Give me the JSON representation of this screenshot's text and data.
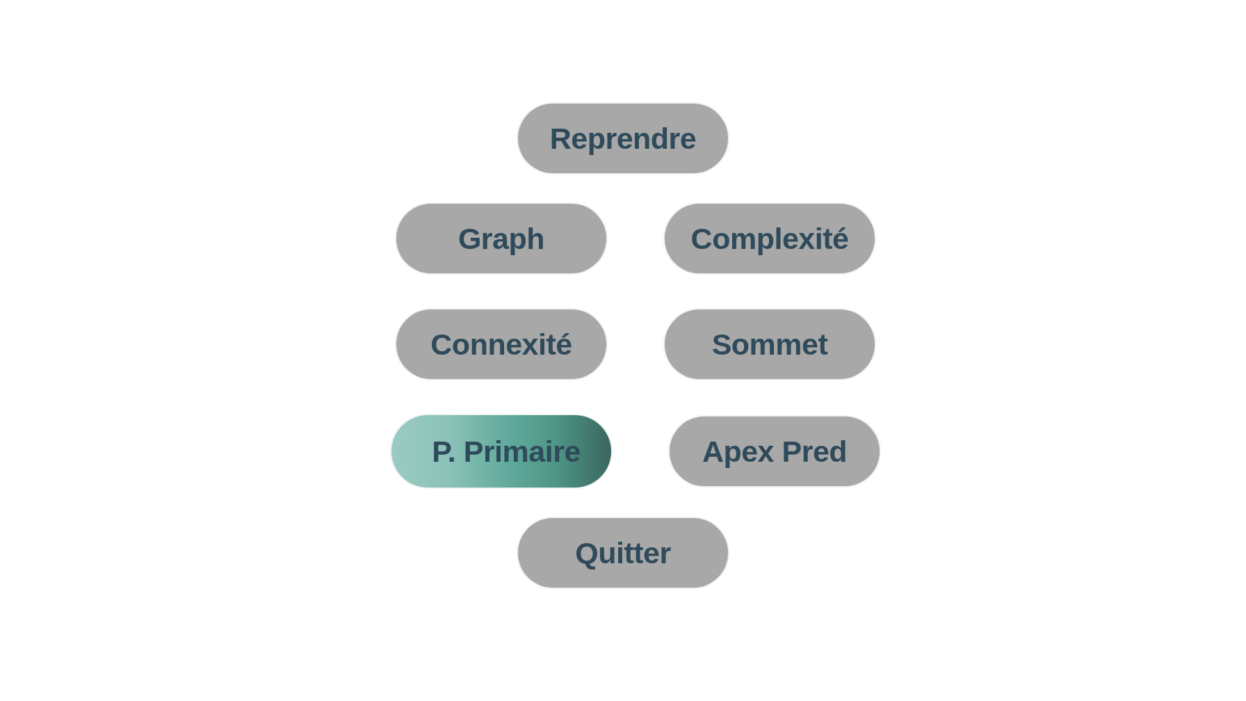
{
  "menu": {
    "rows": [
      {
        "buttons": [
          {
            "label": "Reprendre",
            "selected": false
          }
        ]
      },
      {
        "buttons": [
          {
            "label": "Graph",
            "selected": false
          },
          {
            "label": "Complexité",
            "selected": false
          }
        ]
      },
      {
        "buttons": [
          {
            "label": "Connexité",
            "selected": false
          },
          {
            "label": "Sommet",
            "selected": false
          }
        ]
      },
      {
        "buttons": [
          {
            "label": "P. Primaire",
            "selected": true
          },
          {
            "label": "Apex Pred",
            "selected": false
          }
        ]
      },
      {
        "buttons": [
          {
            "label": "Quitter",
            "selected": false
          }
        ]
      }
    ]
  }
}
